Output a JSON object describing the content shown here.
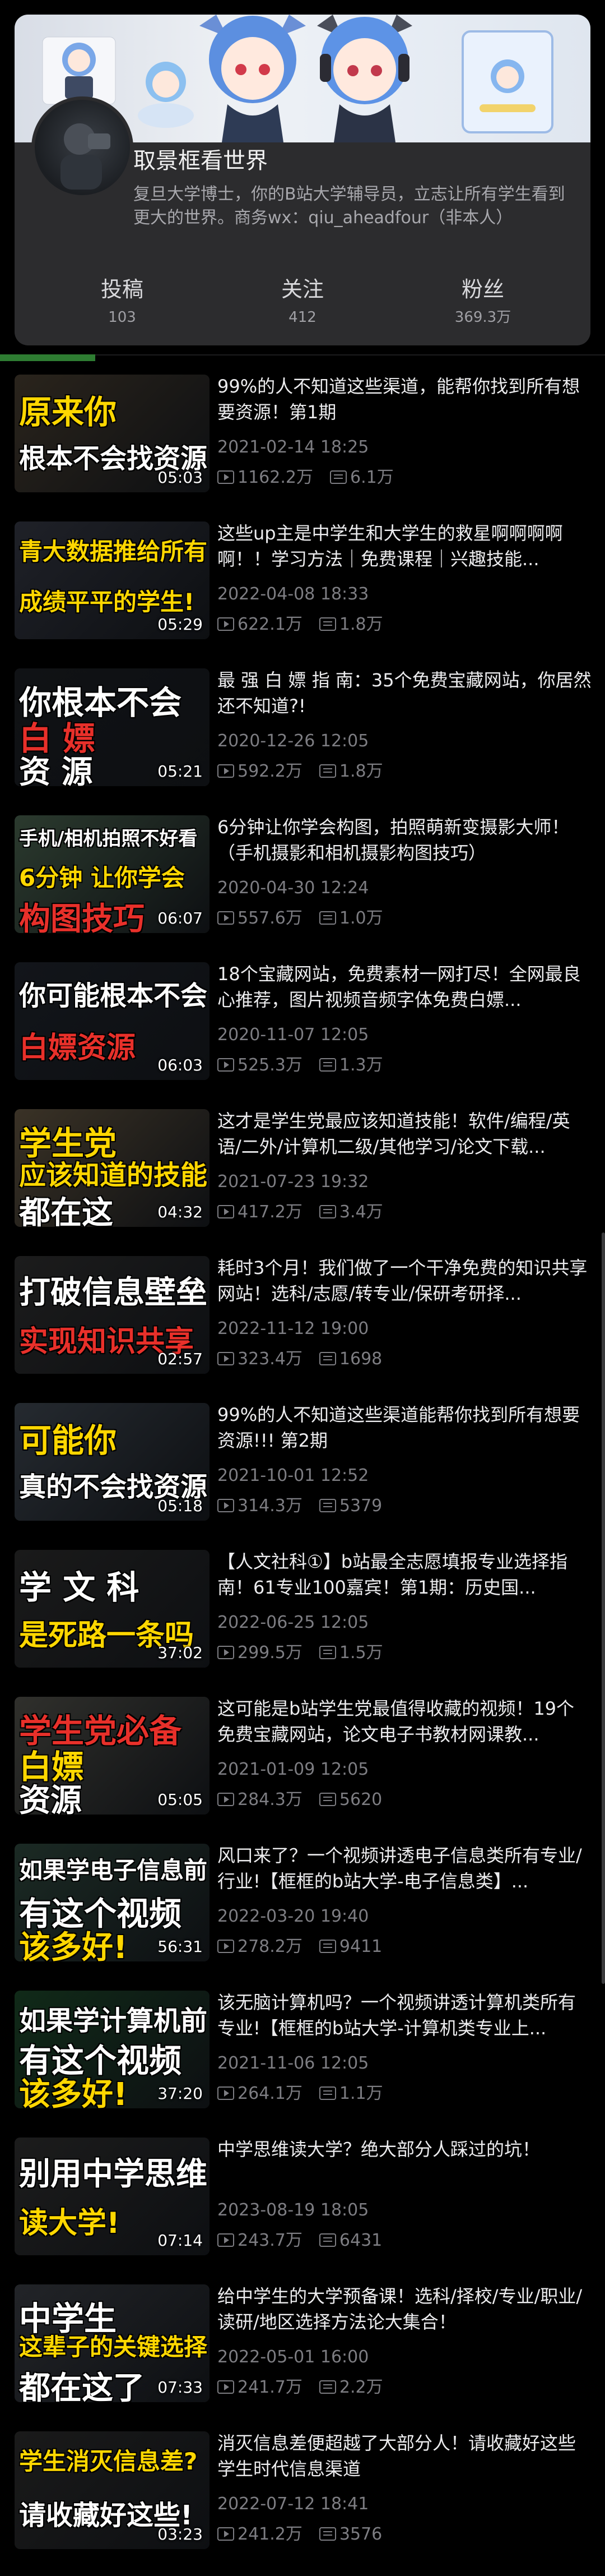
{
  "profile": {
    "name": "取景框看世界",
    "bio": "复旦大学博士，你的B站大学辅导员，立志让所有学生看到更大的世界。商务wx：qiu_aheadfour（非本人）",
    "stats": [
      {
        "label": "投稿",
        "value": "103"
      },
      {
        "label": "关注",
        "value": "412"
      },
      {
        "label": "粉丝",
        "value": "369.3万"
      }
    ]
  },
  "videos": [
    {
      "title": "99%的人不知道这些渠道，能帮你找到所有想要资源！第1期",
      "date": "2021-02-14 18:25",
      "views": "1162.2万",
      "danmaku": "6.1万",
      "duration": "05:03",
      "thumb": {
        "l1": "原来你",
        "l2": "根本不会找资源",
        "l3": "",
        "c1": "#ffd700",
        "c2": "#ffffff",
        "c3": "#ffffff",
        "bg": "#2a241c"
      }
    },
    {
      "title": "这些up主是中学生和大学生的救星啊啊啊啊啊！！学习方法｜免费课程｜兴趣技能...",
      "date": "2022-04-08 18:33",
      "views": "622.1万",
      "danmaku": "1.8万",
      "duration": "05:29",
      "thumb": {
        "l1": "青大数据推给所有",
        "l2": "成绩平平的学生!",
        "l3": "",
        "c1": "#ffd700",
        "c2": "#ffd700",
        "c3": "#ffffff",
        "bg": "#1f2128"
      }
    },
    {
      "title": "最 强 白 嫖 指 南：35个免费宝藏网站，你居然还不知道?!",
      "date": "2020-12-26 12:05",
      "views": "592.2万",
      "danmaku": "1.8万",
      "duration": "05:21",
      "thumb": {
        "l1": "你根本不会",
        "l2": "白 嫖",
        "l3": "资 源",
        "c1": "#ffffff",
        "c2": "#e8302a",
        "c3": "#ffffff",
        "bg": "#101215"
      }
    },
    {
      "title": "6分钟让你学会构图，拍照萌新变摄影大师！（手机摄影和相机摄影构图技巧）",
      "date": "2020-04-30 12:24",
      "views": "557.6万",
      "danmaku": "1.0万",
      "duration": "06:07",
      "thumb": {
        "l1": "手机/相机拍照不好看",
        "l2": "6分钟 让你学会",
        "l3": "构图技巧",
        "c1": "#ffffff",
        "c2": "#ffd700",
        "c3": "#e8302a",
        "bg": "#2b3a2e"
      }
    },
    {
      "title": "18个宝藏网站，免费素材一网打尽！全网最良心推荐，图片视频音频字体免费白嫖...",
      "date": "2020-11-07 12:05",
      "views": "525.3万",
      "danmaku": "1.3万",
      "duration": "06:03",
      "thumb": {
        "l1": "你可能根本不会",
        "l2": "白嫖资源",
        "l3": "",
        "c1": "#ffffff",
        "c2": "#e8302a",
        "c3": "#ffffff",
        "bg": "#12151a"
      }
    },
    {
      "title": "这才是学生党最应该知道技能！软件/编程/英语/二外/计算机二级/其他学习/论文下载...",
      "date": "2021-07-23 19:32",
      "views": "417.2万",
      "danmaku": "3.4万",
      "duration": "04:32",
      "thumb": {
        "l1": "学生党",
        "l2": "应该知道的技能",
        "l3": "都在这",
        "c1": "#ffd700",
        "c2": "#ffd700",
        "c3": "#ffffff",
        "bg": "#3a3226"
      }
    },
    {
      "title": "耗时3个月！我们做了一个干净免费的知识共享网站！选科/志愿/转专业/保研考研择...",
      "date": "2022-11-12 19:00",
      "views": "323.4万",
      "danmaku": "1698",
      "duration": "02:57",
      "thumb": {
        "l1": "打破信息壁垒",
        "l2": "实现知识共享",
        "l3": "",
        "c1": "#ffffff",
        "c2": "#e8302a",
        "c3": "#ffffff",
        "bg": "#1c1c1c"
      }
    },
    {
      "title": "99%的人不知道这些渠道能帮你找到所有想要资源!!! 第2期",
      "date": "2021-10-01 12:52",
      "views": "314.3万",
      "danmaku": "5379",
      "duration": "05:18",
      "thumb": {
        "l1": "可能你",
        "l2": "真的不会找资源",
        "l3": "",
        "c1": "#ffd700",
        "c2": "#ffffff",
        "c3": "#ffffff",
        "bg": "#252a30"
      }
    },
    {
      "title": "【人文社科①】b站最全志愿填报专业选择指南！61专业100嘉宾！第1期：历史国...",
      "date": "2022-06-25 12:05",
      "views": "299.5万",
      "danmaku": "1.5万",
      "duration": "37:02",
      "thumb": {
        "l1": "学 文 科",
        "l2": "是死路一条吗",
        "l3": "",
        "c1": "#ffffff",
        "c2": "#ffd700",
        "c3": "#ffffff",
        "bg": "#1a1a1a"
      }
    },
    {
      "title": "这可能是b站学生党最值得收藏的视频！19个免费宝藏网站，论文电子书教材网课教...",
      "date": "2021-01-09 12:05",
      "views": "284.3万",
      "danmaku": "5620",
      "duration": "05:05",
      "thumb": {
        "l1": "学生党必备",
        "l2": "白嫖",
        "l3": "资源",
        "c1": "#e8302a",
        "c2": "#ffd700",
        "c3": "#ffffff",
        "bg": "#30302c"
      }
    },
    {
      "title": "风口来了？一个视频讲透电子信息类所有专业/行业!【框框的b站大学-电子信息类】...",
      "date": "2022-03-20 19:40",
      "views": "278.2万",
      "danmaku": "9411",
      "duration": "56:31",
      "thumb": {
        "l1": "如果学电子信息前",
        "l2": "有这个视频",
        "l3": "该多好!",
        "c1": "#ffffff",
        "c2": "#ffffff",
        "c3": "#ffd700",
        "bg": "#1b2a24"
      }
    },
    {
      "title": "该无脑计算机吗？一个视频讲透计算机类所有专业!【框框的b站大学-计算机类专业上...",
      "date": "2021-11-06 12:05",
      "views": "264.1万",
      "danmaku": "1.1万",
      "duration": "37:20",
      "thumb": {
        "l1": "如果学计算机前",
        "l2": "有这个视频",
        "l3": "该多好!",
        "c1": "#ffffff",
        "c2": "#ffffff",
        "c3": "#ffd700",
        "bg": "#102a18"
      }
    },
    {
      "title": "中学思维读大学？绝大部分人踩过的坑！",
      "date": "2023-08-19 18:05",
      "views": "243.7万",
      "danmaku": "6431",
      "duration": "07:14",
      "thumb": {
        "l1": "别用中学思维",
        "l2": "读大学!",
        "l3": "",
        "c1": "#ffffff",
        "c2": "#ffd700",
        "c3": "#ffffff",
        "bg": "#1c1c1c"
      }
    },
    {
      "title": "给中学生的大学预备课！选科/择校/专业/职业/读研/地区选择方法论大集合！",
      "date": "2022-05-01 16:00",
      "views": "241.7万",
      "danmaku": "2.2万",
      "duration": "07:33",
      "thumb": {
        "l1": "中学生",
        "l2": "这辈子的关键选择",
        "l3": "都在这了",
        "c1": "#ffffff",
        "c2": "#ffd700",
        "c3": "#ffffff",
        "bg": "#222428"
      }
    },
    {
      "title": "消灭信息差便超越了大部分人！请收藏好这些学生时代信息渠道",
      "date": "2022-07-12 18:41",
      "views": "241.2万",
      "danmaku": "3576",
      "duration": "03:23",
      "thumb": {
        "l1": "学生消灭信息差?",
        "l2": "请收藏好这些!",
        "l3": "",
        "c1": "#ffd700",
        "c2": "#ffffff",
        "c3": "#ffffff",
        "bg": "#1a1a1a"
      }
    }
  ]
}
